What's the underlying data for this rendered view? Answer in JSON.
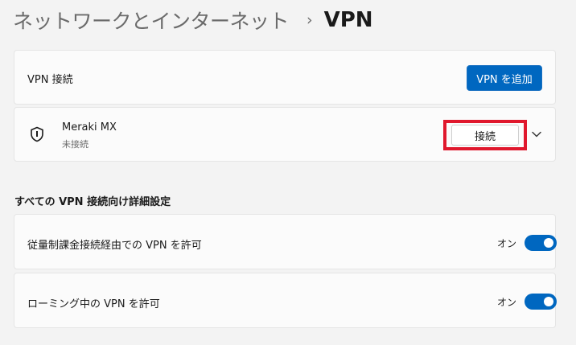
{
  "breadcrumb": {
    "parent": "ネットワークとインターネット",
    "separator": "›",
    "current": "VPN"
  },
  "vpn_connections": {
    "label": "VPN 接続",
    "add_button": "VPN を追加"
  },
  "connection": {
    "icon": "shield-icon",
    "name": "Meraki MX",
    "status": "未接続",
    "connect_button": "接続",
    "expand_icon": "chevron-down-icon"
  },
  "advanced": {
    "title": "すべての VPN 接続向け詳細設定",
    "settings": [
      {
        "label": "従量制課金接続経由での VPN を許可",
        "state": "オン",
        "enabled": true
      },
      {
        "label": "ローミング中の VPN を許可",
        "state": "オン",
        "enabled": true
      }
    ]
  },
  "colors": {
    "accent": "#0067c0",
    "highlight": "#e0182d",
    "background": "#f3f3f3"
  }
}
